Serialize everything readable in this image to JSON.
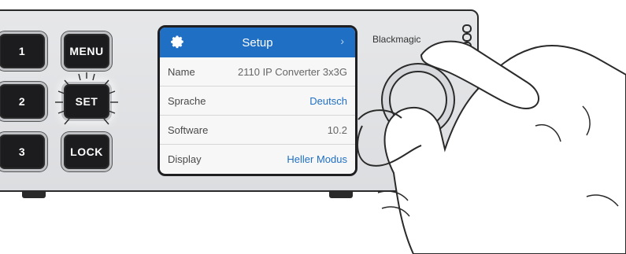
{
  "buttons": {
    "btn1": "1",
    "btn2": "2",
    "btn3": "3",
    "menu": "MENU",
    "set": "SET",
    "lock": "LOCK"
  },
  "screen": {
    "title": "Setup",
    "chevron": "›",
    "rows": [
      {
        "label": "Name",
        "value": "2110 IP Converter 3x3G"
      },
      {
        "label": "Sprache",
        "value": "Deutsch"
      },
      {
        "label": "Software",
        "value": "10.2"
      },
      {
        "label": "Display",
        "value": "Heller Modus"
      }
    ]
  },
  "brand": "Blackmagic",
  "colors": {
    "accent": "#1f6fc4",
    "button": "#1c1c1f"
  }
}
